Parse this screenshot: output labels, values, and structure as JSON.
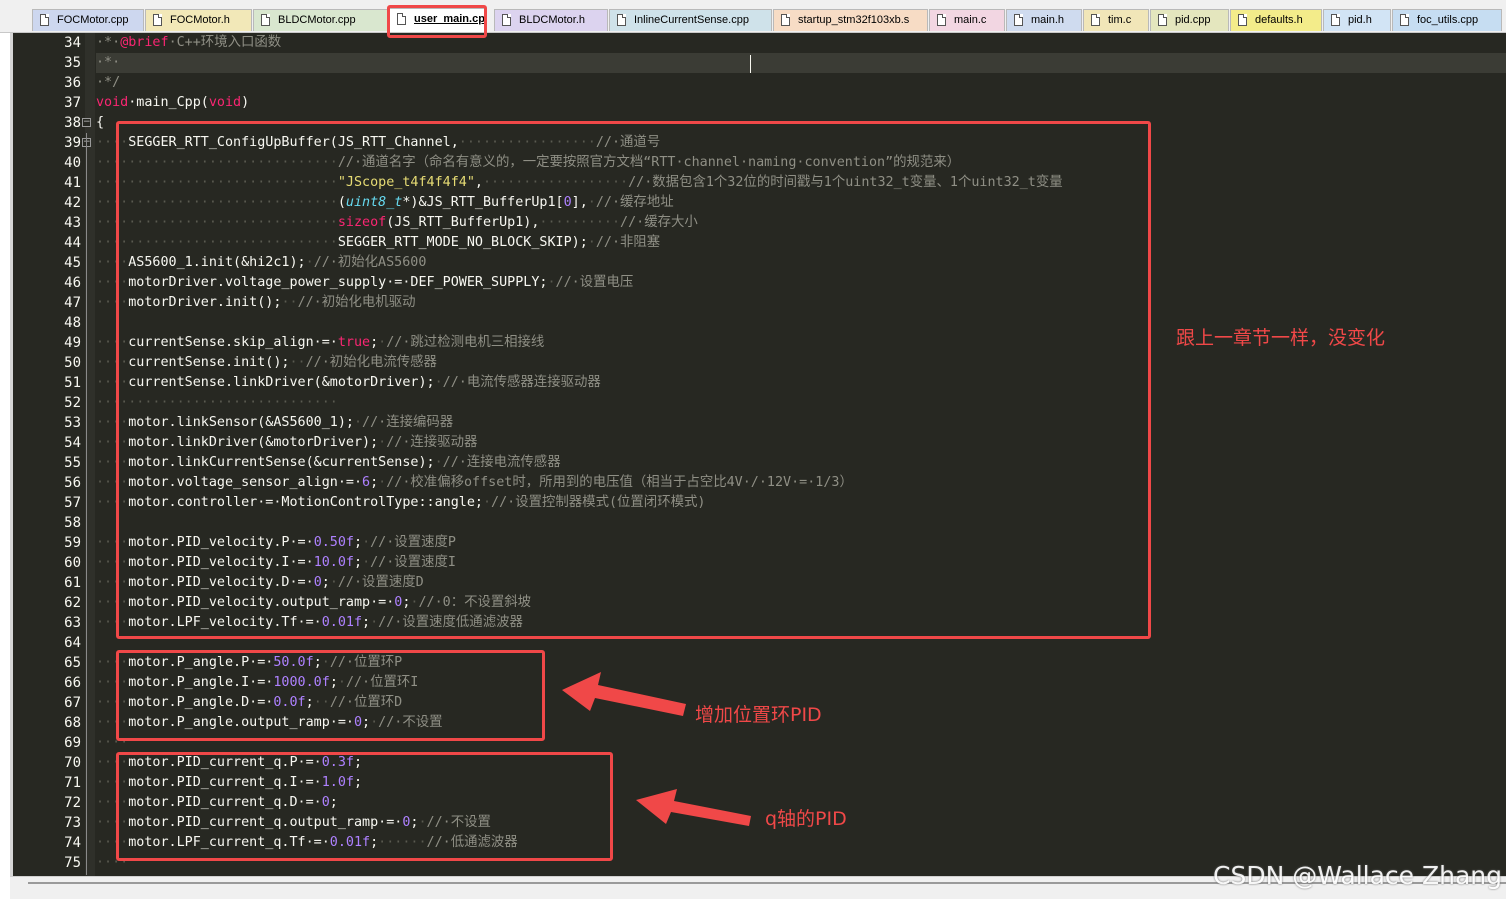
{
  "tabs": [
    {
      "label": "FOCMotor.cpp",
      "color": "#cdd7ef",
      "active": false
    },
    {
      "label": "FOCMotor.h",
      "color": "#f2e8b8",
      "active": false
    },
    {
      "label": "BLDCMotor.cpp",
      "color": "#d9e7cf",
      "active": false
    },
    {
      "label": "user_main.cpp",
      "color": "#f5c6d5",
      "active": true
    },
    {
      "label": "BLDCMotor.h",
      "color": "#dcd3ef",
      "active": false
    },
    {
      "label": "InlineCurrentSense.cpp",
      "color": "#cfe2ea",
      "active": false
    },
    {
      "label": "startup_stm32f103xb.s",
      "color": "#f7dcc5",
      "active": false
    },
    {
      "label": "main.c",
      "color": "#f2d6e2",
      "active": false
    },
    {
      "label": "main.h",
      "color": "#cfdbef",
      "active": false
    },
    {
      "label": "tim.c",
      "color": "#f1e6b8",
      "active": false
    },
    {
      "label": "pid.cpp",
      "color": "#e4e6be",
      "active": false
    },
    {
      "label": "defaults.h",
      "color": "#f3ec8a",
      "active": false
    },
    {
      "label": "pid.h",
      "color": "#d2e4f5",
      "active": false
    },
    {
      "label": "foc_utils.cpp",
      "color": "#c6ddf2",
      "active": false
    }
  ],
  "lines": [
    {
      "n": "34",
      "fold": "",
      "segs": [
        [
          "c-com",
          "·*·"
        ],
        [
          "c-kw",
          "@brief"
        ],
        [
          "c-com",
          "·C++环境入口函数"
        ]
      ]
    },
    {
      "n": "35",
      "fold": "",
      "segs": [
        [
          "c-com",
          "·*·"
        ]
      ]
    },
    {
      "n": "36",
      "fold": "",
      "segs": [
        [
          "c-com",
          "·*/"
        ]
      ]
    },
    {
      "n": "37",
      "fold": "",
      "segs": [
        [
          "c-kw",
          "void"
        ],
        [
          "",
          "·main_Cpp("
        ],
        [
          "c-kw",
          "void"
        ],
        [
          "",
          ")"
        ]
      ]
    },
    {
      "n": "38",
      "fold": "minus",
      "segs": [
        [
          "",
          "{"
        ]
      ]
    },
    {
      "n": "39",
      "fold": "minus",
      "segs": [
        [
          "c-dot",
          "····"
        ],
        [
          "",
          "SEGGER_RTT_ConfigUpBuffer(JS_RTT_Channel,"
        ],
        [
          "c-dot",
          "·················"
        ],
        [
          "c-com",
          "//·通道号"
        ]
      ]
    },
    {
      "n": "40",
      "fold": "",
      "segs": [
        [
          "c-dot",
          "······························"
        ],
        [
          "c-com",
          "//·通道名字（命名有意义的，一定要按照官方文档“RTT·channel·naming·convention”的规范来）"
        ]
      ]
    },
    {
      "n": "41",
      "fold": "",
      "segs": [
        [
          "c-dot",
          "······························"
        ],
        [
          "c-str",
          "\"JScope_t4f4f4f4\""
        ],
        [
          "",
          ","
        ],
        [
          "c-dot",
          "··················"
        ],
        [
          "c-com",
          "//·数据包含1个32位的时间戳与1个uint32_t变量、1个uint32_t变量"
        ]
      ]
    },
    {
      "n": "42",
      "fold": "",
      "segs": [
        [
          "c-dot",
          "······························"
        ],
        [
          "",
          "("
        ],
        [
          "c-type",
          "uint8_t"
        ],
        [
          "",
          "*)&JS_RTT_BufferUp1["
        ],
        [
          "c-num",
          "0"
        ],
        [
          "",
          "],"
        ],
        [
          "c-dot",
          "·"
        ],
        [
          "c-com",
          "//·缓存地址"
        ]
      ]
    },
    {
      "n": "43",
      "fold": "",
      "segs": [
        [
          "c-dot",
          "······························"
        ],
        [
          "c-kw",
          "sizeof"
        ],
        [
          "",
          "(JS_RTT_BufferUp1),"
        ],
        [
          "c-dot",
          "··········"
        ],
        [
          "c-com",
          "//·缓存大小"
        ]
      ]
    },
    {
      "n": "44",
      "fold": "",
      "segs": [
        [
          "c-dot",
          "······························"
        ],
        [
          "",
          "SEGGER_RTT_MODE_NO_BLOCK_SKIP);"
        ],
        [
          "c-dot",
          "·"
        ],
        [
          "c-com",
          "//·非阻塞"
        ]
      ]
    },
    {
      "n": "45",
      "fold": "",
      "segs": [
        [
          "c-dot",
          "····"
        ],
        [
          "",
          "AS5600_1.init(&hi2c1);"
        ],
        [
          "c-dot",
          "·"
        ],
        [
          "c-com",
          "//·初始化AS5600"
        ]
      ]
    },
    {
      "n": "46",
      "fold": "",
      "segs": [
        [
          "c-dot",
          "····"
        ],
        [
          "",
          "motorDriver.voltage_power_supply·=·DEF_POWER_SUPPLY;"
        ],
        [
          "c-dot",
          "·"
        ],
        [
          "c-com",
          "//·设置电压"
        ]
      ]
    },
    {
      "n": "47",
      "fold": "",
      "segs": [
        [
          "c-dot",
          "····"
        ],
        [
          "",
          "motorDriver.init();"
        ],
        [
          "c-dot",
          "··"
        ],
        [
          "c-com",
          "//·初始化电机驱动"
        ]
      ]
    },
    {
      "n": "48",
      "fold": "",
      "segs": [
        [
          "c-dot",
          ""
        ]
      ]
    },
    {
      "n": "49",
      "fold": "",
      "segs": [
        [
          "c-dot",
          "····"
        ],
        [
          "",
          "currentSense.skip_align·=·"
        ],
        [
          "c-kw",
          "true"
        ],
        [
          "",
          ";"
        ],
        [
          "c-dot",
          "·"
        ],
        [
          "c-com",
          "//·跳过检测电机三相接线"
        ]
      ]
    },
    {
      "n": "50",
      "fold": "",
      "segs": [
        [
          "c-dot",
          "····"
        ],
        [
          "",
          "currentSense.init();"
        ],
        [
          "c-dot",
          "··"
        ],
        [
          "c-com",
          "//·初始化电流传感器"
        ]
      ]
    },
    {
      "n": "51",
      "fold": "",
      "segs": [
        [
          "c-dot",
          "····"
        ],
        [
          "",
          "currentSense.linkDriver(&motorDriver);"
        ],
        [
          "c-dot",
          "·"
        ],
        [
          "c-com",
          "//·电流传感器连接驱动器"
        ]
      ]
    },
    {
      "n": "52",
      "fold": "",
      "segs": [
        [
          "c-dot",
          "······························"
        ]
      ]
    },
    {
      "n": "53",
      "fold": "",
      "segs": [
        [
          "c-dot",
          "····"
        ],
        [
          "",
          "motor.linkSensor(&AS5600_1);"
        ],
        [
          "c-dot",
          "·"
        ],
        [
          "c-com",
          "//·连接编码器"
        ]
      ]
    },
    {
      "n": "54",
      "fold": "",
      "segs": [
        [
          "c-dot",
          "····"
        ],
        [
          "",
          "motor.linkDriver(&motorDriver);"
        ],
        [
          "c-dot",
          "·"
        ],
        [
          "c-com",
          "//·连接驱动器"
        ]
      ]
    },
    {
      "n": "55",
      "fold": "",
      "segs": [
        [
          "c-dot",
          "····"
        ],
        [
          "",
          "motor.linkCurrentSense(&currentSense);"
        ],
        [
          "c-dot",
          "·"
        ],
        [
          "c-com",
          "//·连接电流传感器"
        ]
      ]
    },
    {
      "n": "56",
      "fold": "",
      "segs": [
        [
          "c-dot",
          "····"
        ],
        [
          "",
          "motor.voltage_sensor_align·=·"
        ],
        [
          "c-num",
          "6"
        ],
        [
          "",
          ";"
        ],
        [
          "c-dot",
          "·"
        ],
        [
          "c-com",
          "//·校准偏移offset时，所用到的电压值（相当于占空比4V·/·12V·=·1/3）"
        ]
      ]
    },
    {
      "n": "57",
      "fold": "",
      "segs": [
        [
          "c-dot",
          "····"
        ],
        [
          "",
          "motor.controller·=·MotionControlType::angle;"
        ],
        [
          "c-dot",
          "·"
        ],
        [
          "c-com",
          "//·设置控制器模式(位置闭环模式)"
        ]
      ]
    },
    {
      "n": "58",
      "fold": "",
      "segs": [
        [
          "c-dot",
          ""
        ]
      ]
    },
    {
      "n": "59",
      "fold": "",
      "segs": [
        [
          "c-dot",
          "····"
        ],
        [
          "",
          "motor.PID_velocity.P·=·"
        ],
        [
          "c-num",
          "0.50f"
        ],
        [
          "",
          ";"
        ],
        [
          "c-dot",
          "·"
        ],
        [
          "c-com",
          "//·设置速度P"
        ]
      ]
    },
    {
      "n": "60",
      "fold": "",
      "segs": [
        [
          "c-dot",
          "····"
        ],
        [
          "",
          "motor.PID_velocity.I·=·"
        ],
        [
          "c-num",
          "10.0f"
        ],
        [
          "",
          ";"
        ],
        [
          "c-dot",
          "·"
        ],
        [
          "c-com",
          "//·设置速度I"
        ]
      ]
    },
    {
      "n": "61",
      "fold": "",
      "segs": [
        [
          "c-dot",
          "····"
        ],
        [
          "",
          "motor.PID_velocity.D·=·"
        ],
        [
          "c-num",
          "0"
        ],
        [
          "",
          ";"
        ],
        [
          "c-dot",
          "·"
        ],
        [
          "c-com",
          "//·设置速度D"
        ]
      ]
    },
    {
      "n": "62",
      "fold": "",
      "segs": [
        [
          "c-dot",
          "····"
        ],
        [
          "",
          "motor.PID_velocity.output_ramp·=·"
        ],
        [
          "c-num",
          "0"
        ],
        [
          "",
          ";"
        ],
        [
          "c-dot",
          "·"
        ],
        [
          "c-com",
          "//·0：不设置斜坡"
        ]
      ]
    },
    {
      "n": "63",
      "fold": "",
      "segs": [
        [
          "c-dot",
          "····"
        ],
        [
          "",
          "motor.LPF_velocity.Tf·=·"
        ],
        [
          "c-num",
          "0.01f"
        ],
        [
          "",
          ";"
        ],
        [
          "c-dot",
          "·"
        ],
        [
          "c-com",
          "//·设置速度低通滤波器"
        ]
      ]
    },
    {
      "n": "64",
      "fold": "",
      "segs": [
        [
          "c-dot",
          ""
        ]
      ]
    },
    {
      "n": "65",
      "fold": "",
      "segs": [
        [
          "c-dot",
          "····"
        ],
        [
          "",
          "motor.P_angle.P·=·"
        ],
        [
          "c-num",
          "50.0f"
        ],
        [
          "",
          ";"
        ],
        [
          "c-dot",
          "·"
        ],
        [
          "c-com",
          "//·位置环P"
        ]
      ]
    },
    {
      "n": "66",
      "fold": "",
      "segs": [
        [
          "c-dot",
          "····"
        ],
        [
          "",
          "motor.P_angle.I·=·"
        ],
        [
          "c-num",
          "1000.0f"
        ],
        [
          "",
          ";"
        ],
        [
          "c-dot",
          "·"
        ],
        [
          "c-com",
          "//·位置环I"
        ]
      ]
    },
    {
      "n": "67",
      "fold": "",
      "segs": [
        [
          "c-dot",
          "····"
        ],
        [
          "",
          "motor.P_angle.D·=·"
        ],
        [
          "c-num",
          "0.0f"
        ],
        [
          "",
          ";"
        ],
        [
          "c-dot",
          "··"
        ],
        [
          "c-com",
          "//·位置环D"
        ]
      ]
    },
    {
      "n": "68",
      "fold": "",
      "segs": [
        [
          "c-dot",
          "····"
        ],
        [
          "",
          "motor.P_angle.output_ramp·=·"
        ],
        [
          "c-num",
          "0"
        ],
        [
          "",
          ";"
        ],
        [
          "c-dot",
          "·"
        ],
        [
          "c-com",
          "//·不设置"
        ]
      ]
    },
    {
      "n": "69",
      "fold": "",
      "segs": [
        [
          "c-dot",
          "····"
        ]
      ]
    },
    {
      "n": "70",
      "fold": "",
      "segs": [
        [
          "c-dot",
          "····"
        ],
        [
          "",
          "motor.PID_current_q.P·=·"
        ],
        [
          "c-num",
          "0.3f"
        ],
        [
          "",
          ";"
        ]
      ]
    },
    {
      "n": "71",
      "fold": "",
      "segs": [
        [
          "c-dot",
          "····"
        ],
        [
          "",
          "motor.PID_current_q.I·=·"
        ],
        [
          "c-num",
          "1.0f"
        ],
        [
          "",
          ";"
        ]
      ]
    },
    {
      "n": "72",
      "fold": "",
      "segs": [
        [
          "c-dot",
          "····"
        ],
        [
          "",
          "motor.PID_current_q.D·=·"
        ],
        [
          "c-num",
          "0"
        ],
        [
          "",
          ";"
        ]
      ]
    },
    {
      "n": "73",
      "fold": "",
      "segs": [
        [
          "c-dot",
          "····"
        ],
        [
          "",
          "motor.PID_current_q.output_ramp·=·"
        ],
        [
          "c-num",
          "0"
        ],
        [
          "",
          ";"
        ],
        [
          "c-dot",
          "·"
        ],
        [
          "c-com",
          "//·不设置"
        ]
      ]
    },
    {
      "n": "74",
      "fold": "",
      "segs": [
        [
          "c-dot",
          "····"
        ],
        [
          "",
          "motor.LPF_current_q.Tf·=·"
        ],
        [
          "c-num",
          "0.01f"
        ],
        [
          "",
          ";"
        ],
        [
          "c-dot",
          "······"
        ],
        [
          "c-com",
          "//·低通滤波器"
        ]
      ]
    },
    {
      "n": "75",
      "fold": "",
      "segs": [
        [
          "c-dot",
          "····"
        ]
      ]
    }
  ],
  "annotations": {
    "same_as_before": "跟上一章节一样，没变化",
    "add_position_pid": "增加位置环PID",
    "q_axis_pid": "q轴的PID"
  },
  "watermark": "CSDN @Wallace Zhang",
  "colors": {
    "editor_bg": "#272822",
    "annotation_red": "#f04848",
    "comment": "#8f8f85",
    "keyword": "#f92672",
    "number": "#ae81ff",
    "string": "#e6db74"
  }
}
